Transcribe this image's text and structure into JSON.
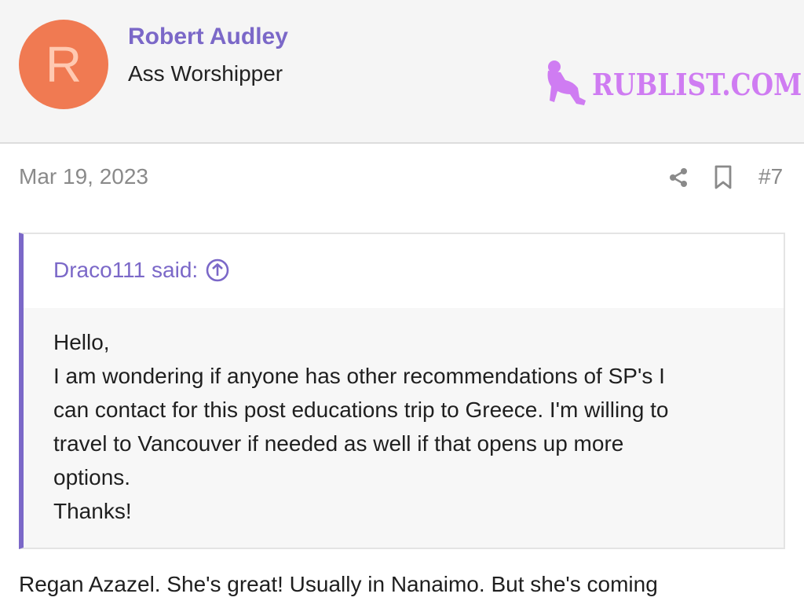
{
  "author": {
    "avatar_letter": "R",
    "name": "Robert Audley",
    "title": "Ass Worshipper",
    "avatar_color": "#f07a52"
  },
  "watermark": {
    "text": "RUBLIST.COM"
  },
  "post": {
    "date": "Mar 19, 2023",
    "number": "#7",
    "share_icon": "share-icon",
    "bookmark_icon": "bookmark-icon"
  },
  "quote": {
    "author_label": "Draco111 said:",
    "lines": [
      "Hello,",
      "I am wondering if anyone has other recommendations of SP's I",
      "can contact for this post educations trip to Greece. I'm willing to",
      "travel to Vancouver if needed as well if that opens up more",
      "options.",
      "Thanks!"
    ],
    "accent_color": "#7b68c8"
  },
  "reply": {
    "text": "Regan Azazel. She's great! Usually in Nanaimo. But she's coming"
  }
}
